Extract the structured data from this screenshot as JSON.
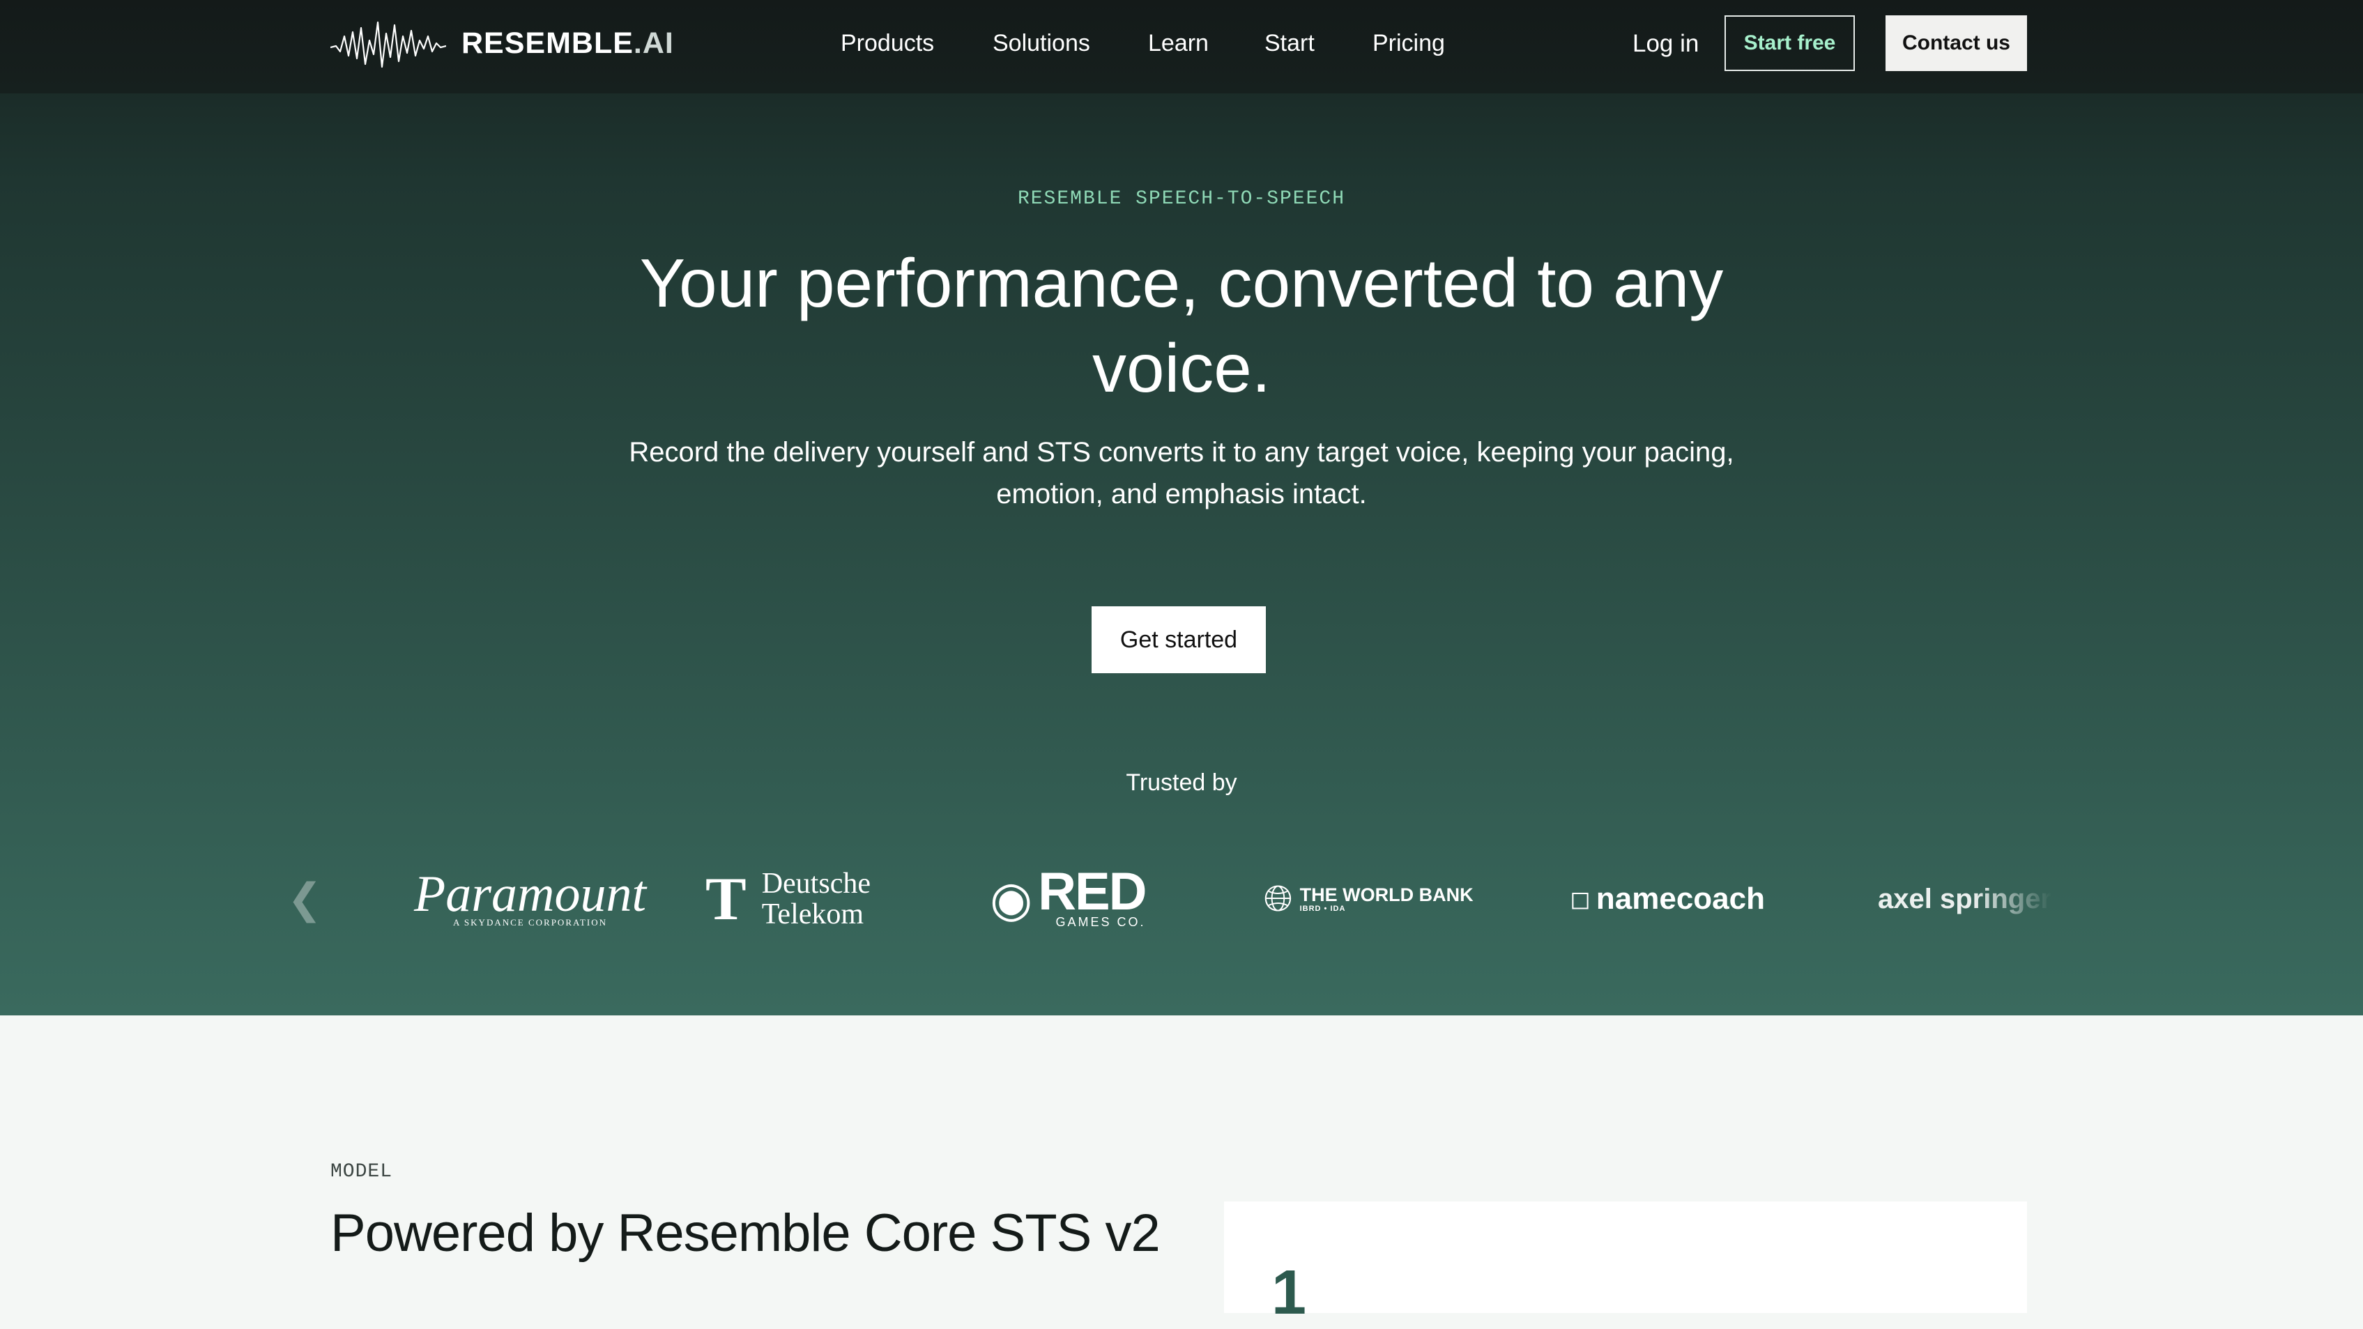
{
  "header": {
    "brand": {
      "name": "RESEMBLE",
      "suffix": ".AI"
    },
    "nav": [
      "Products",
      "Solutions",
      "Learn",
      "Start",
      "Pricing"
    ],
    "login_label": "Log in",
    "start_free_label": "Start free",
    "contact_label": "Contact us"
  },
  "hero": {
    "eyebrow": "RESEMBLE SPEECH-TO-SPEECH",
    "headline": "Your performance, converted to any voice.",
    "subtext": "Record the delivery yourself and STS converts it to any target voice, keeping your pacing, emotion, and emphasis intact.",
    "cta_label": "Get started",
    "trusted_label": "Trusted by"
  },
  "partners": {
    "paramount": {
      "name": "Paramount",
      "tagline": "A SKYDANCE CORPORATION"
    },
    "telekom": {
      "mark": "T",
      "line1": "Deutsche",
      "line2": "Telekom"
    },
    "redgames": {
      "name": "RED",
      "sub": "GAMES CO."
    },
    "worldbank": {
      "name": "THE WORLD BANK",
      "sub": "IBRD • IDA"
    },
    "namecoach": {
      "name": "namecoach"
    },
    "axel": {
      "name": "axel springer"
    }
  },
  "model": {
    "eyebrow": "MODEL",
    "title": "Powered by Resemble Core STS v2",
    "card_number": "1"
  },
  "colors": {
    "accent_mint": "#a7f0cc",
    "hero_top": "#16211f",
    "hero_bottom": "#3a6a5e",
    "section_bg": "#f4f7f5"
  }
}
